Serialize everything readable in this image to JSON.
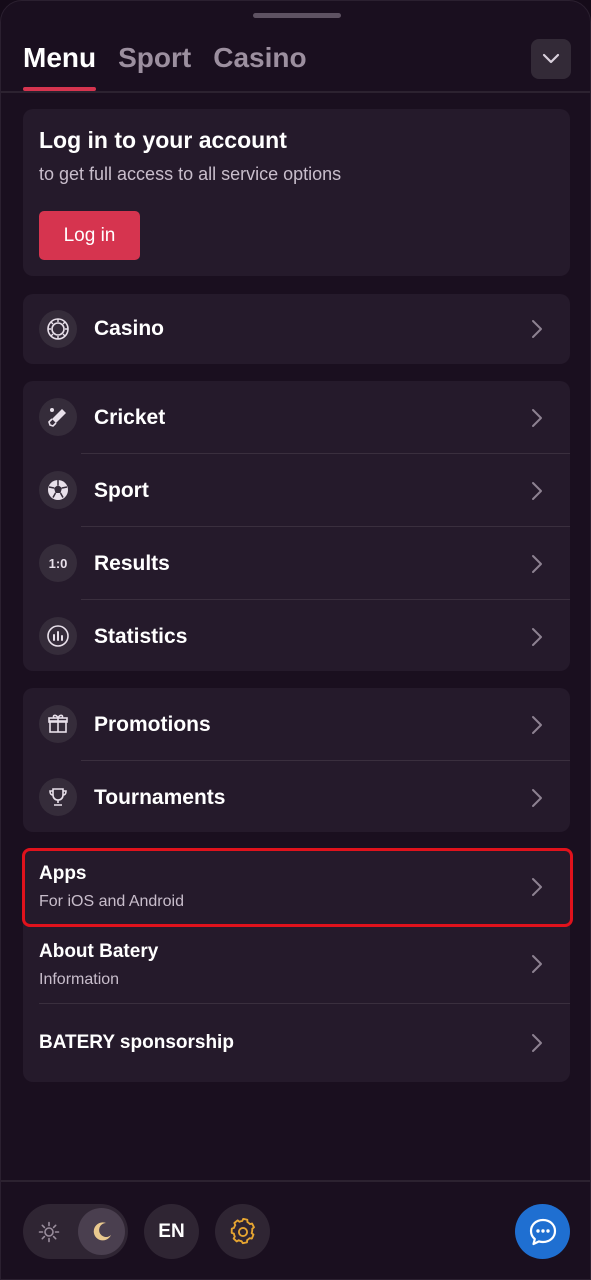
{
  "tabs": [
    {
      "label": "Menu",
      "active": true
    },
    {
      "label": "Sport",
      "active": false
    },
    {
      "label": "Casino",
      "active": false
    }
  ],
  "login": {
    "title": "Log in to your account",
    "subtitle": "to get full access to all service options",
    "button_label": "Log in"
  },
  "casino_section": {
    "items": [
      {
        "label": "Casino",
        "icon": "casino-chip-icon"
      }
    ]
  },
  "sport_section": {
    "items": [
      {
        "label": "Cricket",
        "icon": "cricket-bat-icon"
      },
      {
        "label": "Sport",
        "icon": "soccer-ball-icon"
      },
      {
        "label": "Results",
        "icon": "score-icon",
        "icon_text": "1:0"
      },
      {
        "label": "Statistics",
        "icon": "statistics-icon"
      }
    ]
  },
  "promo_section": {
    "items": [
      {
        "label": "Promotions",
        "icon": "gift-icon"
      },
      {
        "label": "Tournaments",
        "icon": "trophy-icon"
      }
    ]
  },
  "info_section": {
    "items": [
      {
        "title": "Apps",
        "subtitle": "For iOS and Android",
        "highlighted": true
      },
      {
        "title": "About Batery",
        "subtitle": "Information"
      },
      {
        "title": "BATERY sponsorship"
      }
    ]
  },
  "footer": {
    "theme": "dark",
    "language_label": "EN",
    "icons": [
      "sun-icon",
      "moon-icon",
      "gear-icon",
      "chat-icon"
    ]
  },
  "colors": {
    "accent": "#d6344f",
    "highlight_border": "#e0121c",
    "card_bg": "#251a2b",
    "chat_button": "#1f6fd1",
    "settings_icon": "#e6a531"
  }
}
